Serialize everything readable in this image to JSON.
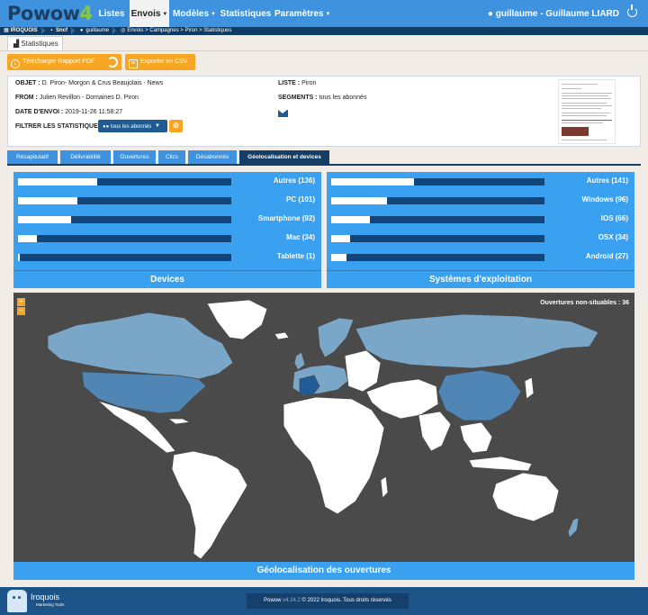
{
  "app": {
    "logo_main": "Powow",
    "logo_accent": "4"
  },
  "nav": {
    "items": [
      {
        "label": "Listes"
      },
      {
        "label": "Envois"
      },
      {
        "label": "Modèles"
      },
      {
        "label": "Statistiques"
      },
      {
        "label": "Paramètres"
      }
    ],
    "active": "Envois",
    "user": "guillaume - Guillaume LIARD"
  },
  "breadcrumb": [
    "IROQUOIS",
    "Sncf",
    "guillaume",
    "Envois > Campagnes > Piron > Statistiques"
  ],
  "page_tab": "Statistiques",
  "actions": {
    "pdf_label": "Télécharger Rapport PDF",
    "csv_label": "Exporter en CSV"
  },
  "info": {
    "objet_label": "OBJET :",
    "objet_value": "D. Piron- Morgon & Crus Beaujolais - News",
    "from_label": "FROM :",
    "from_value": "Julien Revillon - Domaines D. Piron",
    "date_label": "DATE D'ENVOI :",
    "date_value": "2019-11-26 11:58:27",
    "filter_label": "FILTRER LES STATISTIQUES :",
    "filter_value": "tous les abonnés",
    "liste_label": "LISTE :",
    "liste_value": "Piron",
    "segments_label": "SEGMENTS :",
    "segments_value": "tous les abonnés"
  },
  "tabs": [
    {
      "label": "Récapitulatif"
    },
    {
      "label": "Délivrabilité"
    },
    {
      "label": "Ouvertures"
    },
    {
      "label": "Clics"
    },
    {
      "label": "Désabonnés"
    },
    {
      "label": "Géolocalisation et devices"
    }
  ],
  "active_tab": "Géolocalisation et devices",
  "devices": {
    "title": "Devices",
    "rows": [
      {
        "label": "Autres (136)",
        "fraction": 0.37
      },
      {
        "label": "PC (101)",
        "fraction": 0.28
      },
      {
        "label": "Smartphone (92)",
        "fraction": 0.25
      },
      {
        "label": "Mac (34)",
        "fraction": 0.09
      },
      {
        "label": "Tablette (1)",
        "fraction": 0.01
      }
    ]
  },
  "os": {
    "title": "Systèmes d'exploitation",
    "rows": [
      {
        "label": "Autres (141)",
        "fraction": 0.39
      },
      {
        "label": "Windows (96)",
        "fraction": 0.26
      },
      {
        "label": "IOS (66)",
        "fraction": 0.18
      },
      {
        "label": "OSX (34)",
        "fraction": 0.09
      },
      {
        "label": "Android (27)",
        "fraction": 0.07
      }
    ]
  },
  "map": {
    "title": "Géolocalisation des ouvertures",
    "non_situables": "Ouvertures non-situables : 36",
    "zoom_in": "+",
    "zoom_out": "−",
    "colors": {
      "ocean": "#4a4a4a",
      "none": "#ffffff",
      "low": "#7aa6c8",
      "mid": "#4f86b5",
      "high": "#1f5c98"
    }
  },
  "footer": {
    "brand": "Iroquois",
    "brand_sub": "Marketing Tools",
    "app_name": "Powow",
    "version": "v4.24.2",
    "copyright": "© 2022 Iroquois. Tous droits réservés"
  }
}
